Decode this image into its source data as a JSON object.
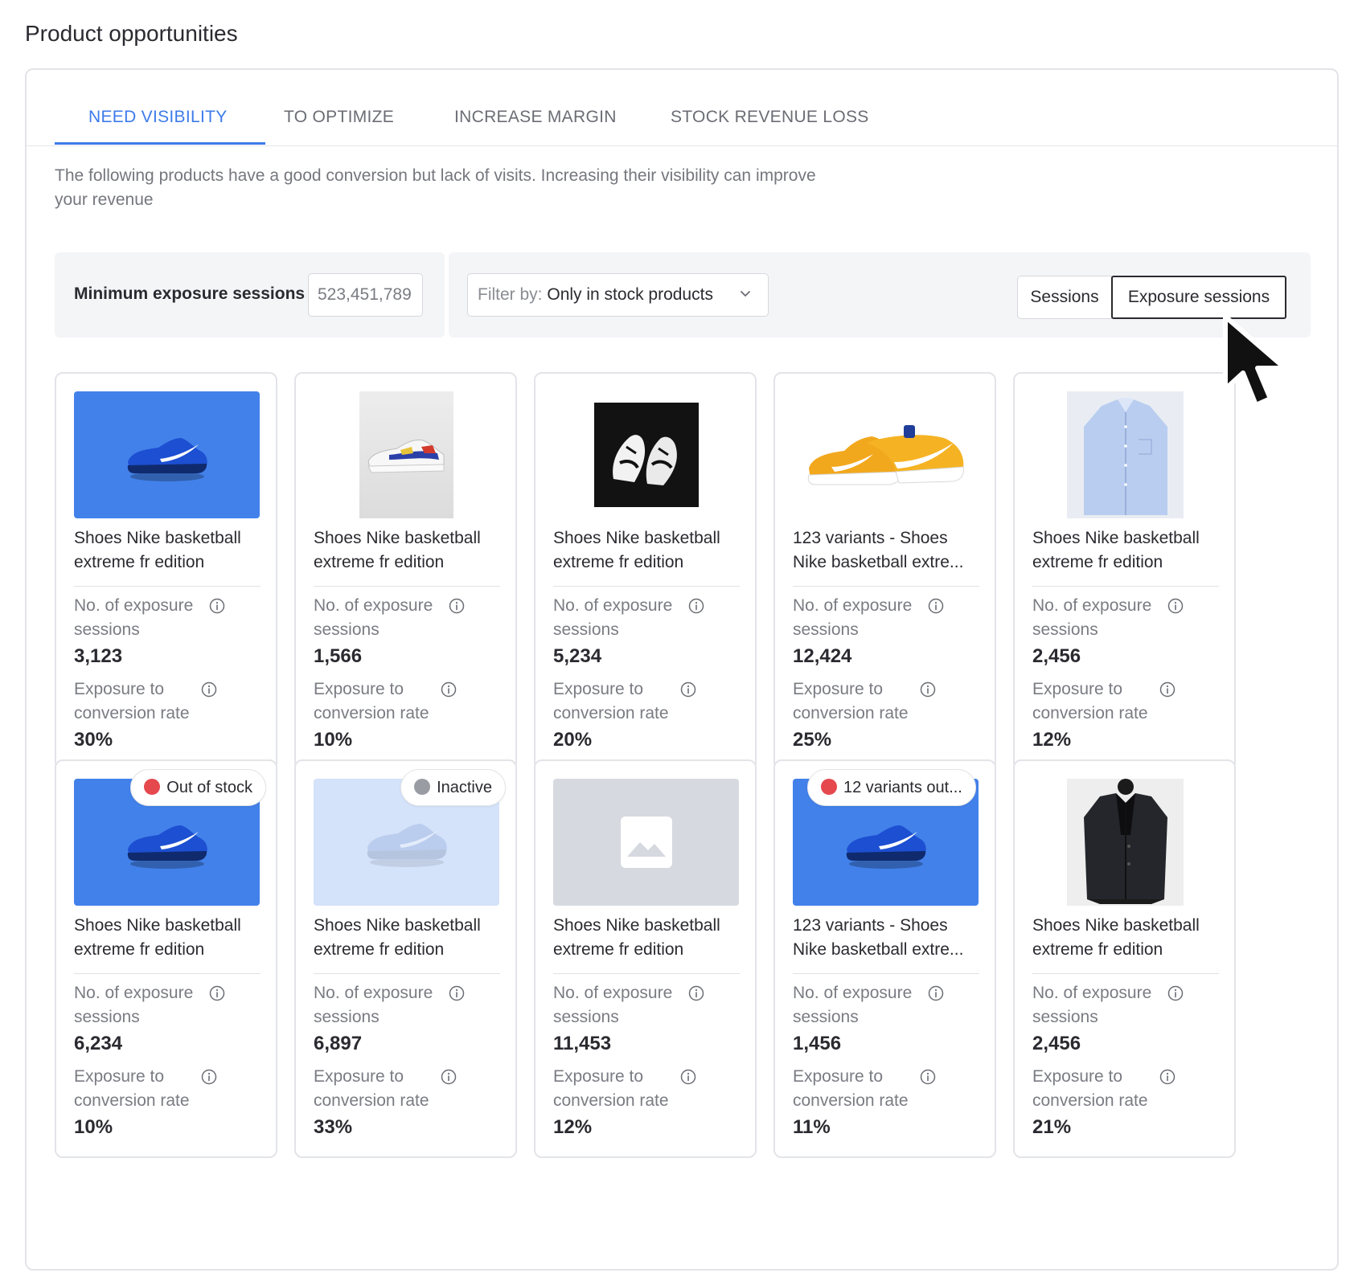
{
  "page": {
    "title": "Product opportunities"
  },
  "tabs": [
    {
      "label": "NEED VISIBILITY",
      "active": true
    },
    {
      "label": "TO OPTIMIZE",
      "active": false
    },
    {
      "label": "INCREASE MARGIN",
      "active": false
    },
    {
      "label": "STOCK REVENUE LOSS",
      "active": false
    }
  ],
  "description": "The following products have a good conversion but lack of visits. Increasing their visibility can improve your revenue",
  "filters": {
    "min_label": "Minimum exposure sessions",
    "min_value": "523,451,789",
    "filter_prefix": "Filter by:",
    "filter_value": "Only in stock products",
    "toggle": {
      "sessions": "Sessions",
      "exposure": "Exposure sessions",
      "selected": "Exposure sessions"
    }
  },
  "metric_labels": {
    "exposure_sessions": "No. of exposure sessions",
    "conversion_rate": "Exposure to conversion rate"
  },
  "colors": {
    "accent": "#3d7bea",
    "out_of_stock": "#e5484d",
    "inactive": "#9a9ca3"
  },
  "products": [
    {
      "name_bold": "",
      "name": "Shoes Nike basketball extreme fr edition",
      "exposure": "3,123",
      "conversion": "30%",
      "image": "blue-sneaker",
      "badge": null
    },
    {
      "name_bold": "",
      "name": "Shoes Nike basketball extreme fr edition",
      "exposure": "1,566",
      "conversion": "10%",
      "image": "white-sneaker",
      "badge": null
    },
    {
      "name_bold": "",
      "name": "Shoes Nike basketball extreme fr edition",
      "exposure": "5,234",
      "conversion": "20%",
      "image": "black-sneaker",
      "badge": null
    },
    {
      "name_bold": "123 variants",
      "name": " - Shoes Nike basketball extre...",
      "exposure": "12,424",
      "conversion": "25%",
      "image": "yellow-sneaker",
      "badge": null
    },
    {
      "name_bold": "",
      "name": "Shoes Nike basketball extreme fr edition",
      "exposure": "2,456",
      "conversion": "12%",
      "image": "blue-shirt",
      "badge": null
    },
    {
      "name_bold": "",
      "name": "Shoes Nike basketball extreme fr edition",
      "exposure": "6,234",
      "conversion": "10%",
      "image": "blue-sneaker",
      "badge": {
        "label": "Out of stock",
        "status": "out"
      }
    },
    {
      "name_bold": "",
      "name": "Shoes Nike basketball extreme fr edition",
      "exposure": "6,897",
      "conversion": "33%",
      "image": "blue-sneaker-faded",
      "badge": {
        "label": "Inactive",
        "status": "inactive"
      }
    },
    {
      "name_bold": "",
      "name": "Shoes Nike basketball extreme fr edition",
      "exposure": "11,453",
      "conversion": "12%",
      "image": "placeholder-image",
      "badge": null
    },
    {
      "name_bold": "123 variants",
      "name": " - Shoes Nike basketball extre...",
      "exposure": "1,456",
      "conversion": "11%",
      "image": "blue-sneaker",
      "badge": {
        "label": "12 variants out...",
        "status": "out"
      }
    },
    {
      "name_bold": "",
      "name": "Shoes Nike basketball extreme fr edition",
      "exposure": "2,456",
      "conversion": "21%",
      "image": "black-coat",
      "badge": null
    }
  ]
}
